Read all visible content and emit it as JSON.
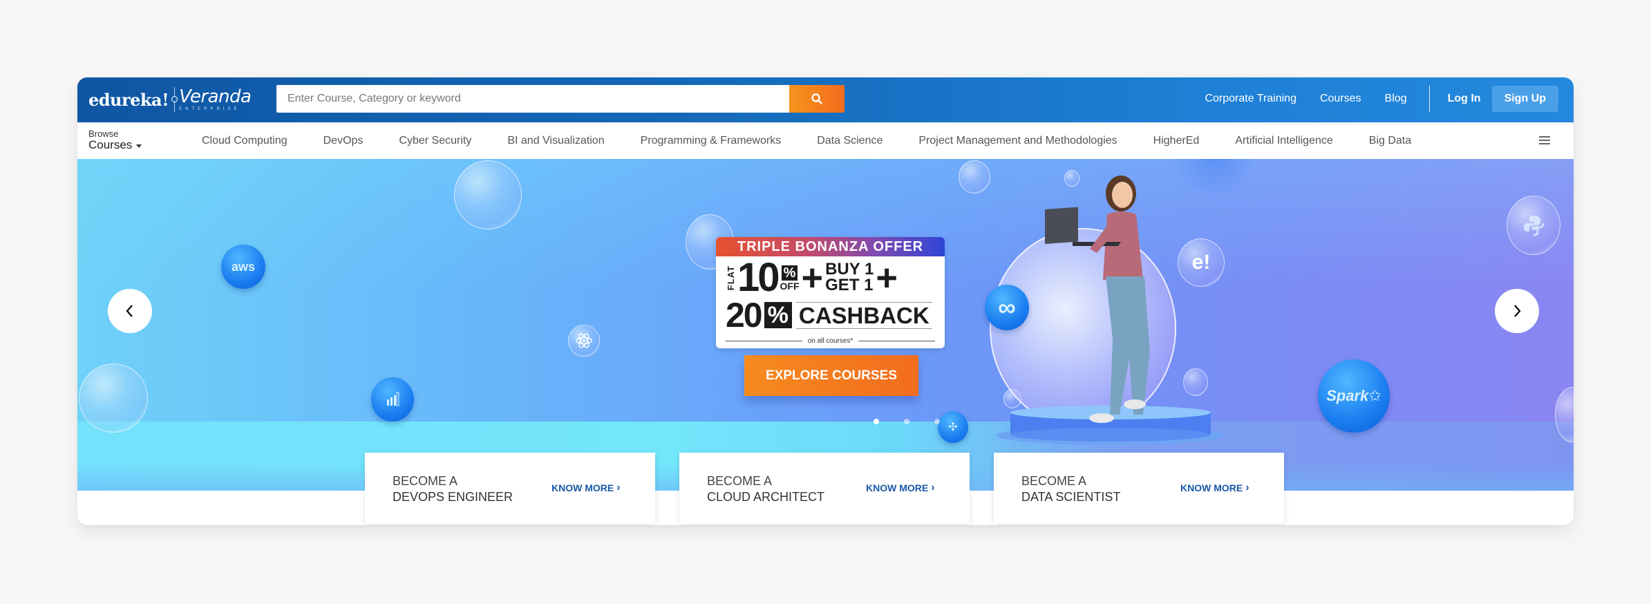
{
  "header": {
    "logo_primary": "edureka!",
    "logo_secondary": "Veranda",
    "logo_tagline": "ENTERPRISE",
    "search": {
      "placeholder": "Enter Course, Category or keyword",
      "value": "",
      "button_icon": "search-icon"
    },
    "nav": {
      "corporate_training": "Corporate Training",
      "courses": "Courses",
      "blog": "Blog",
      "login": "Log In",
      "signup": "Sign Up"
    }
  },
  "category_bar": {
    "browse_label": "Browse",
    "courses_label": "Courses",
    "categories": [
      "Cloud Computing",
      "DevOps",
      "Cyber Security",
      "BI and Visualization",
      "Programming & Frameworks",
      "Data Science",
      "Project Management and Methodologies",
      "HigherEd",
      "Artificial Intelligence",
      "Big Data"
    ],
    "menu_icon": "hamburger-menu-icon"
  },
  "hero": {
    "offer": {
      "title": "TRIPLE BONANZA OFFER",
      "flat": "FLAT",
      "discount": "10",
      "discount_pct": "%",
      "off": "OFF",
      "plus": "+",
      "buy": "BUY 1",
      "get": "GET 1",
      "cashback_value": "20",
      "cashback_pct": "%",
      "cashback_label": "CASHBACK",
      "footnote": "on all courses*"
    },
    "cta": "EXPLORE COURSES",
    "slides": {
      "count": 3,
      "active": 1
    },
    "tech_badges": [
      "aws",
      "power-bi",
      "react",
      "devops-infinity",
      "edureka",
      "python",
      "tableau",
      "spark"
    ],
    "spark_label": "Spark",
    "aws_label": "aws",
    "edureka_badge": "e!"
  },
  "cards": [
    {
      "line1": "BECOME A",
      "line2": "DEVOPS ENGINEER",
      "link": "KNOW MORE"
    },
    {
      "line1": "BECOME A",
      "line2": "CLOUD ARCHITECT",
      "link": "KNOW MORE"
    },
    {
      "line1": "BECOME A",
      "line2": "DATA SCIENTIST",
      "link": "KNOW MORE"
    }
  ],
  "colors": {
    "header_blue": "#1468b8",
    "search_orange": "#f68b1f",
    "signup_bg": "#4aa0e8",
    "link_blue": "#1a58a8"
  }
}
